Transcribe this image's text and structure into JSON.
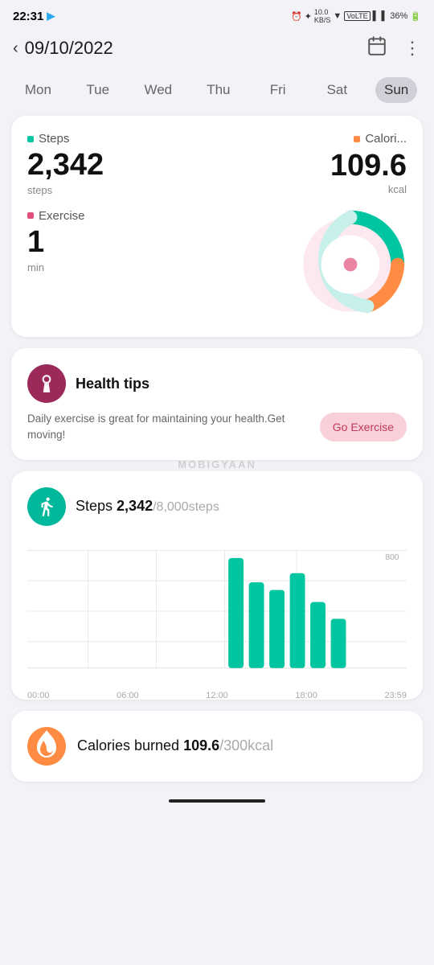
{
  "statusBar": {
    "time": "22:31",
    "battery": "36%"
  },
  "topNav": {
    "date": "09/10/2022",
    "backLabel": "‹"
  },
  "days": [
    {
      "label": "Mon",
      "active": false
    },
    {
      "label": "Tue",
      "active": false
    },
    {
      "label": "Wed",
      "active": false
    },
    {
      "label": "Thu",
      "active": false
    },
    {
      "label": "Fri",
      "active": false
    },
    {
      "label": "Sat",
      "active": false
    },
    {
      "label": "Sun",
      "active": true
    }
  ],
  "summary": {
    "stepsLabel": "Steps",
    "stepsValue": "2,342",
    "stepsUnit": "steps",
    "caloriesLabel": "Calori...",
    "caloriesValue": "109.6",
    "caloriesUnit": "kcal",
    "exerciseLabel": "Exercise",
    "exerciseValue": "1",
    "exerciseUnit": "min"
  },
  "healthTips": {
    "title": "Health tips",
    "text": "Daily exercise is great for maintaining your health.Get moving!",
    "buttonLabel": "Go Exercise"
  },
  "stepsChart": {
    "title": "Steps",
    "count": "2,342",
    "goal": "/8,000steps",
    "yAxisLabel": "800",
    "xLabels": [
      "00:00",
      "06:00",
      "12:00",
      "18:00",
      "23:59"
    ],
    "bars": [
      {
        "x": 0.52,
        "height": 0.95,
        "teal": true
      },
      {
        "x": 0.57,
        "height": 0.7,
        "teal": true
      },
      {
        "x": 0.62,
        "height": 0.65,
        "teal": true
      },
      {
        "x": 0.67,
        "height": 0.75,
        "teal": true
      },
      {
        "x": 0.72,
        "height": 0.55,
        "teal": true
      },
      {
        "x": 0.77,
        "height": 0.4,
        "teal": true
      }
    ]
  },
  "caloriesBurned": {
    "label": "Calories burned",
    "count": "109.6",
    "goal": "/300kcal"
  },
  "watermark": "MOBIGYAAN"
}
